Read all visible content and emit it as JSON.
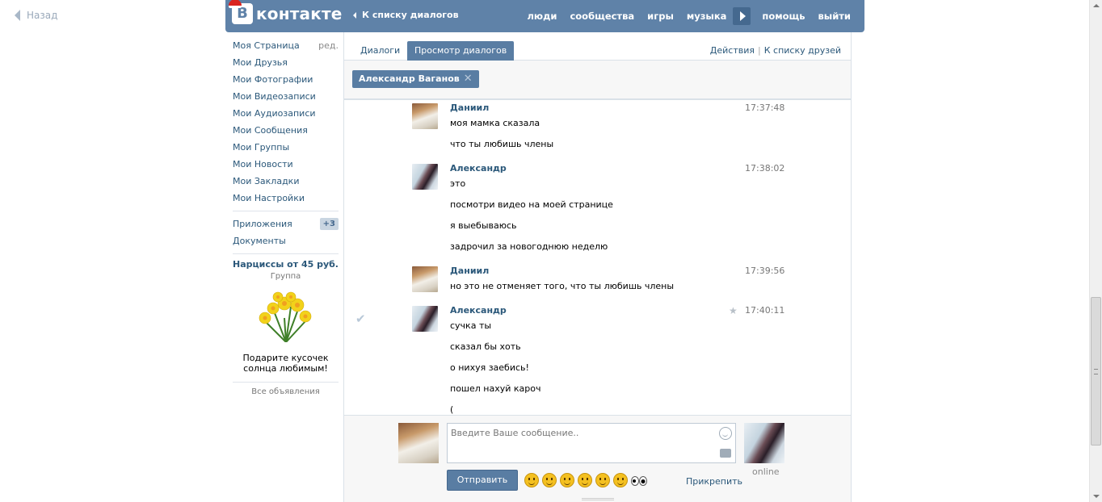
{
  "back": {
    "label": "Назад"
  },
  "header": {
    "logo_text": "контакте",
    "logo_mark": "В",
    "back_to_list": "К списку диалогов",
    "nav": [
      "люди",
      "сообщества",
      "игры",
      "музыка"
    ],
    "nav_right": [
      "помощь",
      "выйти"
    ]
  },
  "sidebar": {
    "items": [
      {
        "label": "Моя Страница",
        "aux": "ред."
      },
      {
        "label": "Мои Друзья"
      },
      {
        "label": "Мои Фотографии"
      },
      {
        "label": "Мои Видеозаписи"
      },
      {
        "label": "Мои Аудиозаписи"
      },
      {
        "label": "Мои Сообщения"
      },
      {
        "label": "Мои Группы"
      },
      {
        "label": "Мои Новости"
      },
      {
        "label": "Мои Закладки"
      },
      {
        "label": "Мои Настройки"
      }
    ],
    "apps": {
      "label": "Приложения",
      "badge": "+3"
    },
    "docs": {
      "label": "Документы"
    },
    "ad": {
      "title": "Нарциссы от 45 руб.",
      "subtitle": "Группа",
      "description": "Подарите кусочек солнца любимым!",
      "all_ads": "Все объявления"
    }
  },
  "tabs": {
    "dialogs": "Диалоги",
    "view": "Просмотр диалогов",
    "actions": "Действия",
    "friends_list": "К списку друзей"
  },
  "filter": {
    "chip": "Александр Ваганов",
    "chip_close": "✕"
  },
  "messages": [
    {
      "author": "Даниил",
      "time": "17:37:48",
      "lines": [
        "моя мамка сказала",
        "что ты любишь члены"
      ]
    },
    {
      "author": "Александр",
      "time": "17:38:02",
      "lines": [
        "это",
        "посмотри видео на моей странице",
        "я выебываюсь",
        "задрочил за новогоднюю неделю"
      ]
    },
    {
      "author": "Даниил",
      "time": "17:39:56",
      "lines": [
        "но это не отменяет того, что ты любишь члены"
      ]
    },
    {
      "author": "Александр",
      "time": "17:40:11",
      "lines": [
        "сучка ты",
        "сказал бы хоть",
        "о нихуя заебись!",
        "пошел нахуй кароч",
        "("
      ]
    }
  ],
  "compose": {
    "placeholder": "Введите Ваше сообщение..",
    "send": "Отправить",
    "attach": "Прикрепить",
    "status": "online"
  },
  "colors": {
    "header": "#5f82a8",
    "link": "#2b587a",
    "button": "#597da3"
  }
}
